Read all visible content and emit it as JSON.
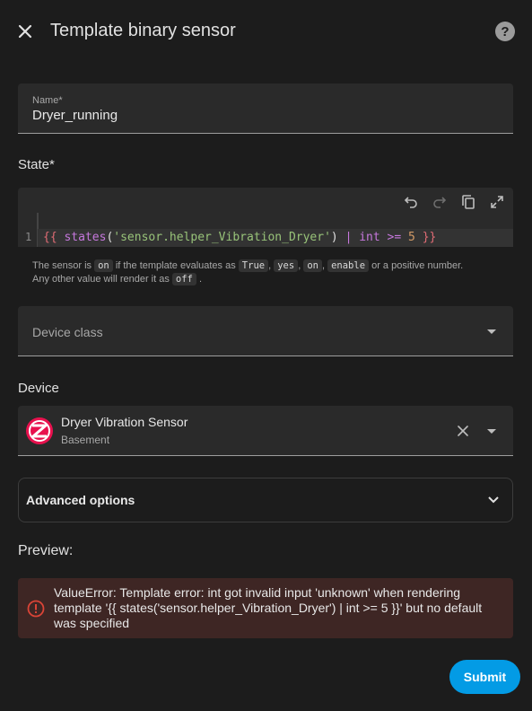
{
  "dialog": {
    "title": "Template binary sensor",
    "close_icon": "close-icon",
    "help_icon": "help-circle-icon"
  },
  "name_field": {
    "label": "Name*",
    "value": "Dryer_running"
  },
  "state": {
    "label": "State*",
    "toolbar_icons": [
      "undo-icon",
      "redo-icon",
      "copy-icon",
      "fullscreen-icon"
    ],
    "line_number": "1",
    "code": {
      "open": "{{",
      "func": "states",
      "paren_open": "(",
      "string": "'sensor.helper_Vibration_Dryer'",
      "paren_close": ")",
      "pipe": "|",
      "filter": "int",
      "op": ">=",
      "number": "5",
      "close": "}}"
    },
    "helper": {
      "t1": "The sensor is",
      "c1": "on",
      "t2": "if the template evaluates as",
      "c2": "True",
      "s1": ",",
      "c3": "yes",
      "s2": ",",
      "c4": "on",
      "s3": ",",
      "c5": "enable",
      "t3": "or a positive number.",
      "t4": "Any other value will render it as",
      "c6": "off",
      "t5": "."
    }
  },
  "device_class": {
    "placeholder": "Device class"
  },
  "device": {
    "label": "Device",
    "name": "Dryer Vibration Sensor",
    "area": "Basement",
    "brand_icon": "zigbee-icon"
  },
  "advanced": {
    "title": "Advanced options"
  },
  "preview": {
    "label": "Preview:",
    "error": "ValueError: Template error: int got invalid input 'unknown' when rendering template '{{ states('sensor.helper_Vibration_Dryer') | int >= 5 }}' but no default was specified"
  },
  "actions": {
    "submit": "Submit"
  },
  "colors": {
    "background": "#1c1c1c",
    "field": "#2a2a2a",
    "accent": "#039be5",
    "error_bg": "#3e2624",
    "error_icon": "#db4437",
    "zigbee": "#e8114e"
  }
}
